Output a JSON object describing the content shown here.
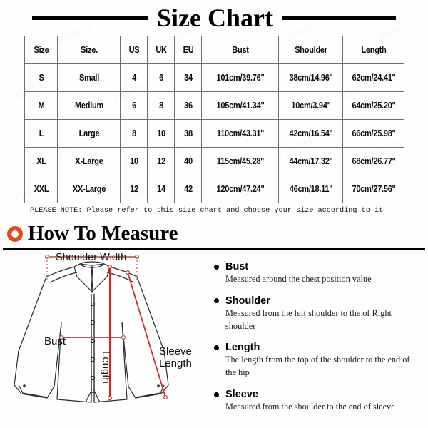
{
  "title": "Size Chart",
  "table": {
    "headers": [
      "Size",
      "Size.",
      "US",
      "UK",
      "EU",
      "Bust",
      "Shoulder",
      "Length"
    ],
    "rows": [
      [
        "S",
        "Small",
        "4",
        "6",
        "34",
        "101cm/39.76\"",
        "38cm/14.96\"",
        "62cm/24.41\""
      ],
      [
        "M",
        "Medium",
        "6",
        "8",
        "36",
        "105cm/41.34\"",
        "10cm/3.94\"",
        "64cm/25.20\""
      ],
      [
        "L",
        "Large",
        "8",
        "10",
        "38",
        "110cm/43.31\"",
        "42cm/16.54\"",
        "66cm/25.98\""
      ],
      [
        "XL",
        "X-Large",
        "10",
        "12",
        "40",
        "115cm/45.28\"",
        "44cm/17.32\"",
        "68cm/26.77\""
      ],
      [
        "XXL",
        "XX-Large",
        "12",
        "14",
        "42",
        "120cm/47.24\"",
        "46cm/18.11\"",
        "70cm/27.56\""
      ]
    ]
  },
  "please_note": "PLEASE NOTE: Please refer to this size chart and choose your size according to it",
  "how_to_measure": {
    "heading": "How To Measure",
    "ring_color": "#e8491d"
  },
  "diagram": {
    "shoulder_width_label": "Shoulder Width",
    "bust_label": "Bust",
    "length_label": "Length",
    "sleeve_label_line1": "Sleeve",
    "sleeve_label_line2": "Length",
    "line_color_red": "#e02020",
    "line_color_bust": "#9c5a56",
    "outline_color": "#2b2b2b"
  },
  "measurements": [
    {
      "name": "Bust",
      "description": "Measured around the chest position value"
    },
    {
      "name": "Shoulder",
      "description": "Measured from the left shoulder to the of Right shoulder"
    },
    {
      "name": "Length",
      "description": "The length from the top of the shoulder to the end of the hip"
    },
    {
      "name": "Sleeve",
      "description": "Measured from the shoulder to the end of sleeve"
    }
  ],
  "watermark": {
    "text": "Célébri",
    "color": "#b07070"
  }
}
